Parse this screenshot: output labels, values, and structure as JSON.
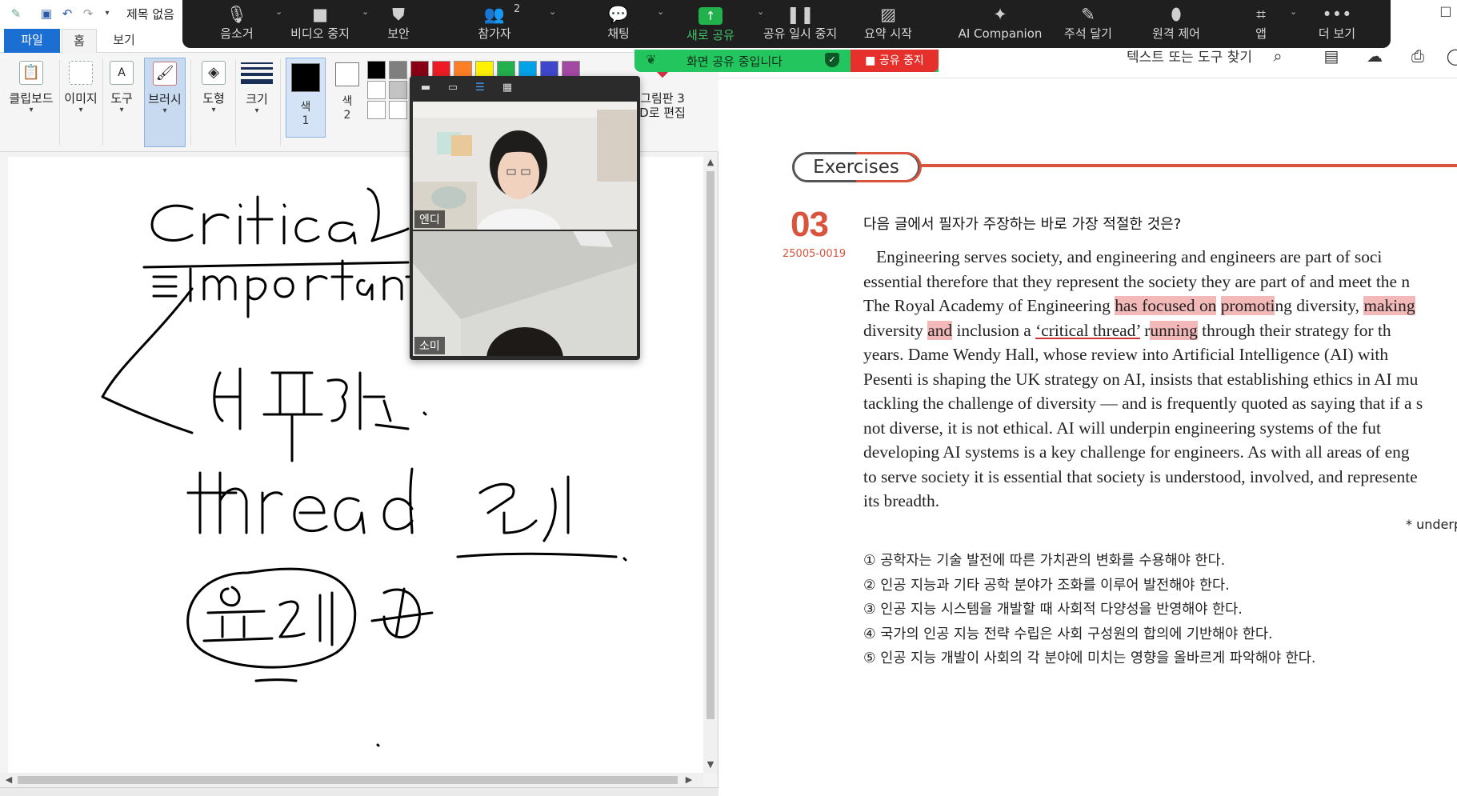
{
  "paint": {
    "title": "제목 없음",
    "tabs": {
      "file": "파일",
      "home": "홈",
      "view": "보기"
    },
    "ribbon": {
      "clipboard": "클립보드",
      "image": "이미지",
      "tools": "도구",
      "brushes": "브러시",
      "shapes": "도형",
      "size": "크기",
      "color1_label": "색",
      "color1_num": "1",
      "color2_label": "색",
      "color2_num": "2",
      "paint3d_line1": "그림판 3",
      "paint3d_line2": "D로 편집"
    },
    "palette": [
      "#000000",
      "#7f7f7f",
      "#880015",
      "#ed1c24",
      "#ff7f27",
      "#fff200",
      "#22b14c",
      "#00a2e8",
      "#3f48cc",
      "#a349a4"
    ],
    "color1_value": "#000000",
    "color2_value": "#ffffff"
  },
  "zoom": {
    "mute": "음소거",
    "stop_video": "비디오 중지",
    "security": "보안",
    "participants": "참가자",
    "participants_count": "2",
    "chat": "채팅",
    "new_share": "새로 공유",
    "pause_share": "공유 일시 중지",
    "summary": "요약 시작",
    "ai": "AI Companion",
    "annotate": "주석 달기",
    "remote": "원격 제어",
    "apps": "앱",
    "more": "더 보기",
    "sharing_status": "화면 공유 중입니다",
    "stop_share": "공유 중지",
    "participant_1": "엔디",
    "participant_2": "소미"
  },
  "pdf": {
    "search": "텍스트 또는 도구 찾기",
    "banner": "Exercises",
    "question_number": "03",
    "question_code": "25005-0019",
    "prompt": "다음 글에서 필자가 주장하는 바로 가장 적절한 것은?",
    "passage": {
      "l1": "Engineering serves society, and engineering and engineers are part of soci",
      "l2": "essential therefore that they represent the society they are part of and meet the n",
      "l3a": "The Royal Academy of Engineering ",
      "l3b": "has focused on",
      "l3c": " ",
      "l3d": "promoti",
      "l3e": "ng diversity, ",
      "l3f": "making",
      "l4a": "diversity ",
      "l4b": "and",
      "l4c": " inclusion a ",
      "l4d": "‘critical thread’",
      "l4e": " r",
      "l4f": "unning",
      "l4g": " through their strategy for th",
      "l5": "years. Dame Wendy Hall, whose review into Artificial Intelligence (AI) with",
      "l6": "Pesenti is shaping the UK strategy on AI, insists that establishing ethics in AI mu",
      "l7": "tackling the challenge of diversity — and is frequently quoted as saying that if a s",
      "l8": "not diverse, it is not ethical. AI will underpin engineering systems of the fut",
      "l9": "developing AI systems is a key challenge for engineers. As with all areas of eng",
      "l10": "to serve society it is essential that society is understood, involved, and represente",
      "l11": "its breadth."
    },
    "footnote": "* underp",
    "choices": [
      "① 공학자는 기술 발전에 따른 가치관의 변화를 수용해야 한다.",
      "② 인공 지능과 기타 공학 분야가 조화를 이루어 발전해야 한다.",
      "③ 인공 지능 시스템을 개발할 때 사회적 다양성을 반영해야 한다.",
      "④ 국가의 인공 지능 전략 수립은 사회 구성원의 합의에 기반해야 한다.",
      "⑤ 인공 지능 개발이 사회의 각 분야에 미치는 영향을 올바르게 파악해야 한다."
    ]
  },
  "colors": {
    "accent_red": "#d9533d",
    "highlight": "#f3b8b8",
    "zoom_bg": "#1f1f1f",
    "share_green": "#22c55e",
    "stop_red": "#e5302c"
  }
}
